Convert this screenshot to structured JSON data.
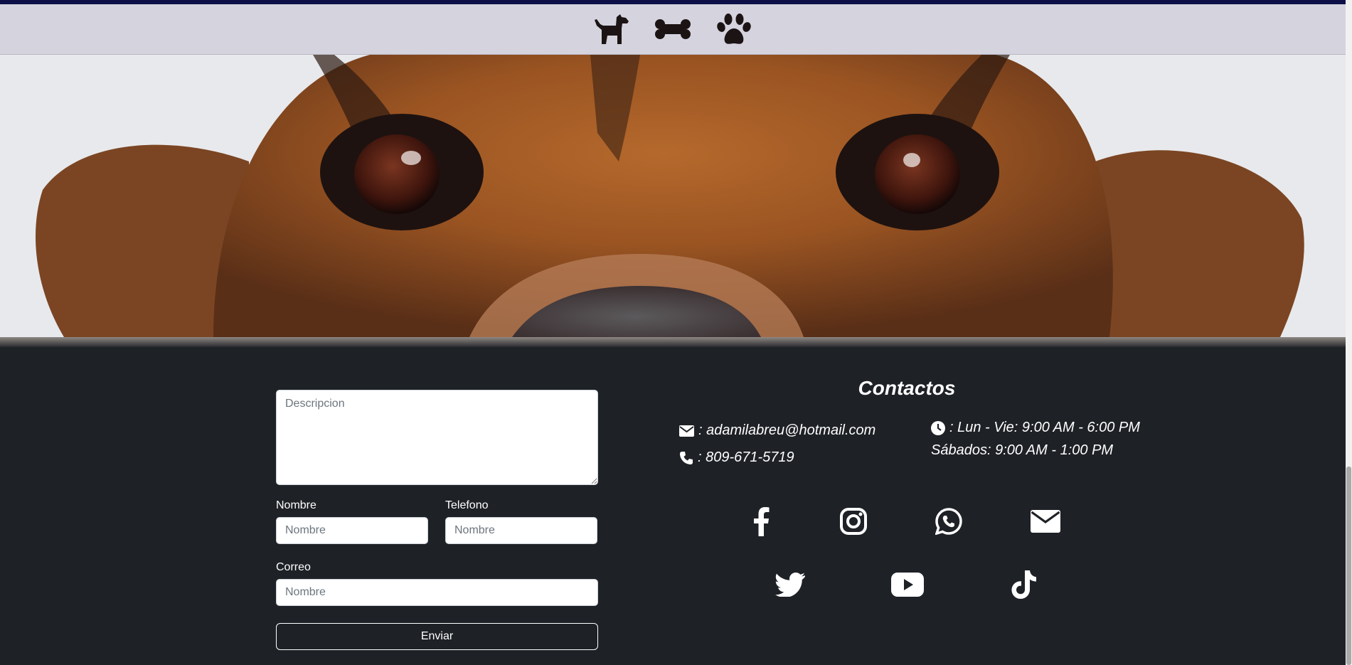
{
  "nav": {
    "icons": [
      "dog-icon",
      "bone-icon",
      "paw-icon"
    ]
  },
  "hero": {
    "alt": "dog-eyes-banner"
  },
  "form": {
    "description_placeholder": "Descripcion",
    "nombre_label": "Nombre",
    "nombre_placeholder": "Nombre",
    "telefono_label": "Telefono",
    "telefono_placeholder": "Nombre",
    "correo_label": "Correo",
    "correo_placeholder": "Nombre",
    "submit_label": "Enviar"
  },
  "contact": {
    "title": "Contactos",
    "email": ": adamilabreu@hotmail.com",
    "phone": ": 809-671-5719",
    "hours_weekday": ": Lun - Vie: 9:00 AM - 6:00 PM",
    "hours_saturday": "Sábados: 9:00 AM - 1:00 PM"
  },
  "social": [
    "facebook-icon",
    "instagram-icon",
    "whatsapp-icon",
    "mail-icon",
    "twitter-icon",
    "youtube-icon",
    "tiktok-icon"
  ],
  "colors": {
    "navbar": "#d4d3de",
    "top_stripe": "#0d1046",
    "footer": "#1e2126",
    "nav_icon": "#1c1414"
  }
}
